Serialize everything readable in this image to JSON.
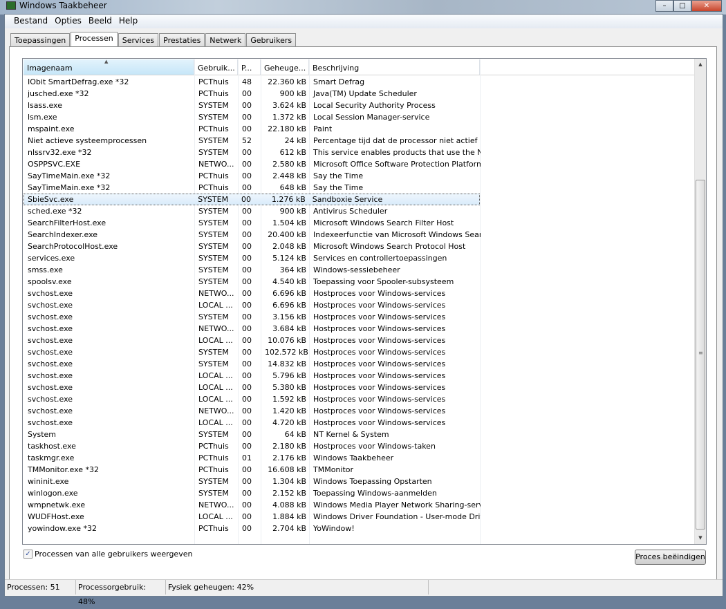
{
  "window": {
    "title": "Windows Taakbeheer",
    "minimize": "–",
    "maximize": "□",
    "close": "✕"
  },
  "menu": [
    "Bestand",
    "Opties",
    "Beeld",
    "Help"
  ],
  "tabs": [
    "Toepassingen",
    "Processen",
    "Services",
    "Prestaties",
    "Netwerk",
    "Gebruikers"
  ],
  "columns": [
    "Imagenaam",
    "Gebruik...",
    "P...",
    "Geheuge...",
    "Beschrijving"
  ],
  "selected_index": 10,
  "processes": [
    [
      "IObit SmartDefrag.exe *32",
      "PCThuis",
      "48",
      "22.360 kB",
      "Smart Defrag"
    ],
    [
      "jusched.exe *32",
      "PCThuis",
      "00",
      "900 kB",
      "Java(TM) Update Scheduler"
    ],
    [
      "lsass.exe",
      "SYSTEM",
      "00",
      "3.624 kB",
      "Local Security Authority Process"
    ],
    [
      "lsm.exe",
      "SYSTEM",
      "00",
      "1.372 kB",
      "Local Session Manager-service"
    ],
    [
      "mspaint.exe",
      "PCThuis",
      "00",
      "22.180 kB",
      "Paint"
    ],
    [
      "Niet actieve systeemprocessen",
      "SYSTEM",
      "52",
      "24 kB",
      "Percentage tijd dat de processor niet actief is"
    ],
    [
      "nlssrv32.exe *32",
      "SYSTEM",
      "00",
      "612 kB",
      "This service enables products that use the Na..."
    ],
    [
      "OSPPSVC.EXE",
      "NETWO...",
      "00",
      "2.580 kB",
      "Microsoft Office Software Protection Platform..."
    ],
    [
      "SayTimeMain.exe *32",
      "PCThuis",
      "00",
      "2.448 kB",
      "Say the Time"
    ],
    [
      "SayTimeMain.exe *32",
      "PCThuis",
      "00",
      "648 kB",
      "Say the Time"
    ],
    [
      "SbieSvc.exe",
      "SYSTEM",
      "00",
      "1.276 kB",
      "Sandboxie Service"
    ],
    [
      "sched.exe *32",
      "SYSTEM",
      "00",
      "900 kB",
      "Antivirus Scheduler"
    ],
    [
      "SearchFilterHost.exe",
      "SYSTEM",
      "00",
      "1.504 kB",
      "Microsoft Windows Search Filter Host"
    ],
    [
      "SearchIndexer.exe",
      "SYSTEM",
      "00",
      "20.400 kB",
      "Indexeerfunctie van Microsoft Windows Search"
    ],
    [
      "SearchProtocolHost.exe",
      "SYSTEM",
      "00",
      "2.048 kB",
      "Microsoft Windows Search Protocol Host"
    ],
    [
      "services.exe",
      "SYSTEM",
      "00",
      "5.124 kB",
      "Services en controllertoepassingen"
    ],
    [
      "smss.exe",
      "SYSTEM",
      "00",
      "364 kB",
      "Windows-sessiebeheer"
    ],
    [
      "spoolsv.exe",
      "SYSTEM",
      "00",
      "4.540 kB",
      "Toepassing voor Spooler-subsysteem"
    ],
    [
      "svchost.exe",
      "NETWO...",
      "00",
      "6.696 kB",
      "Hostproces voor Windows-services"
    ],
    [
      "svchost.exe",
      "LOCAL ...",
      "00",
      "6.696 kB",
      "Hostproces voor Windows-services"
    ],
    [
      "svchost.exe",
      "SYSTEM",
      "00",
      "3.156 kB",
      "Hostproces voor Windows-services"
    ],
    [
      "svchost.exe",
      "NETWO...",
      "00",
      "3.684 kB",
      "Hostproces voor Windows-services"
    ],
    [
      "svchost.exe",
      "LOCAL ...",
      "00",
      "10.076 kB",
      "Hostproces voor Windows-services"
    ],
    [
      "svchost.exe",
      "SYSTEM",
      "00",
      "102.572 kB",
      "Hostproces voor Windows-services"
    ],
    [
      "svchost.exe",
      "SYSTEM",
      "00",
      "14.832 kB",
      "Hostproces voor Windows-services"
    ],
    [
      "svchost.exe",
      "LOCAL ...",
      "00",
      "5.796 kB",
      "Hostproces voor Windows-services"
    ],
    [
      "svchost.exe",
      "LOCAL ...",
      "00",
      "5.380 kB",
      "Hostproces voor Windows-services"
    ],
    [
      "svchost.exe",
      "LOCAL ...",
      "00",
      "1.592 kB",
      "Hostproces voor Windows-services"
    ],
    [
      "svchost.exe",
      "NETWO...",
      "00",
      "1.420 kB",
      "Hostproces voor Windows-services"
    ],
    [
      "svchost.exe",
      "LOCAL ...",
      "00",
      "4.720 kB",
      "Hostproces voor Windows-services"
    ],
    [
      "System",
      "SYSTEM",
      "00",
      "64 kB",
      "NT Kernel & System"
    ],
    [
      "taskhost.exe",
      "PCThuis",
      "00",
      "2.180 kB",
      "Hostproces voor Windows-taken"
    ],
    [
      "taskmgr.exe",
      "PCThuis",
      "01",
      "2.176 kB",
      "Windows Taakbeheer"
    ],
    [
      "TMMonitor.exe *32",
      "PCThuis",
      "00",
      "16.608 kB",
      "TMMonitor"
    ],
    [
      "wininit.exe",
      "SYSTEM",
      "00",
      "1.304 kB",
      "Windows Toepassing Opstarten"
    ],
    [
      "winlogon.exe",
      "SYSTEM",
      "00",
      "2.152 kB",
      "Toepassing Windows-aanmelden"
    ],
    [
      "wmpnetwk.exe",
      "NETWO...",
      "00",
      "4.088 kB",
      "Windows Media Player Network Sharing-service"
    ],
    [
      "WUDFHost.exe",
      "LOCAL ...",
      "00",
      "1.884 kB",
      "Windows Driver Foundation - User-mode Driv..."
    ],
    [
      "yowindow.exe *32",
      "PCThuis",
      "00",
      "2.704 kB",
      "YoWindow!"
    ]
  ],
  "show_all_users": {
    "label": "Processen van alle gebruikers weergeven",
    "checked": true
  },
  "end_process_button": "Proces beëindigen",
  "status": {
    "processes": "Processen: 51",
    "cpu": "Processorgebruik: 48%",
    "memory": "Fysiek geheugen: 42%"
  }
}
